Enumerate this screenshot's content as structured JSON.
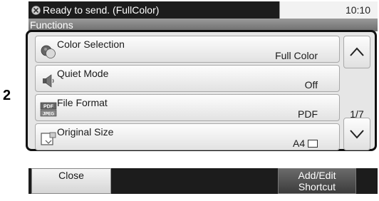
{
  "status": {
    "message": "Ready to send. (FullColor)",
    "time": "10:10"
  },
  "header": {
    "title": "Functions"
  },
  "callout_number": "2",
  "functions": [
    {
      "label": "Color Selection",
      "value": "Full Color",
      "icon": "color-selection-icon"
    },
    {
      "label": "Quiet Mode",
      "value": "Off",
      "icon": "quiet-mode-icon"
    },
    {
      "label": "File Format",
      "value": "PDF",
      "icon": "file-format-icon"
    },
    {
      "label": "Original Size",
      "value": "A4",
      "icon": "original-size-icon"
    }
  ],
  "file_format_icon_text": [
    "PDF",
    "JPEG"
  ],
  "pagination": {
    "indicator": "1/7"
  },
  "footer": {
    "close_label": "Close",
    "shortcut_label": "Add/Edit\nShortcut"
  },
  "colors": {
    "status_bar": "#1c1c1c",
    "header_gradient_top": "#9a9a9a",
    "header_gradient_bottom": "#6d6d6d",
    "panel_border": "#111111"
  }
}
